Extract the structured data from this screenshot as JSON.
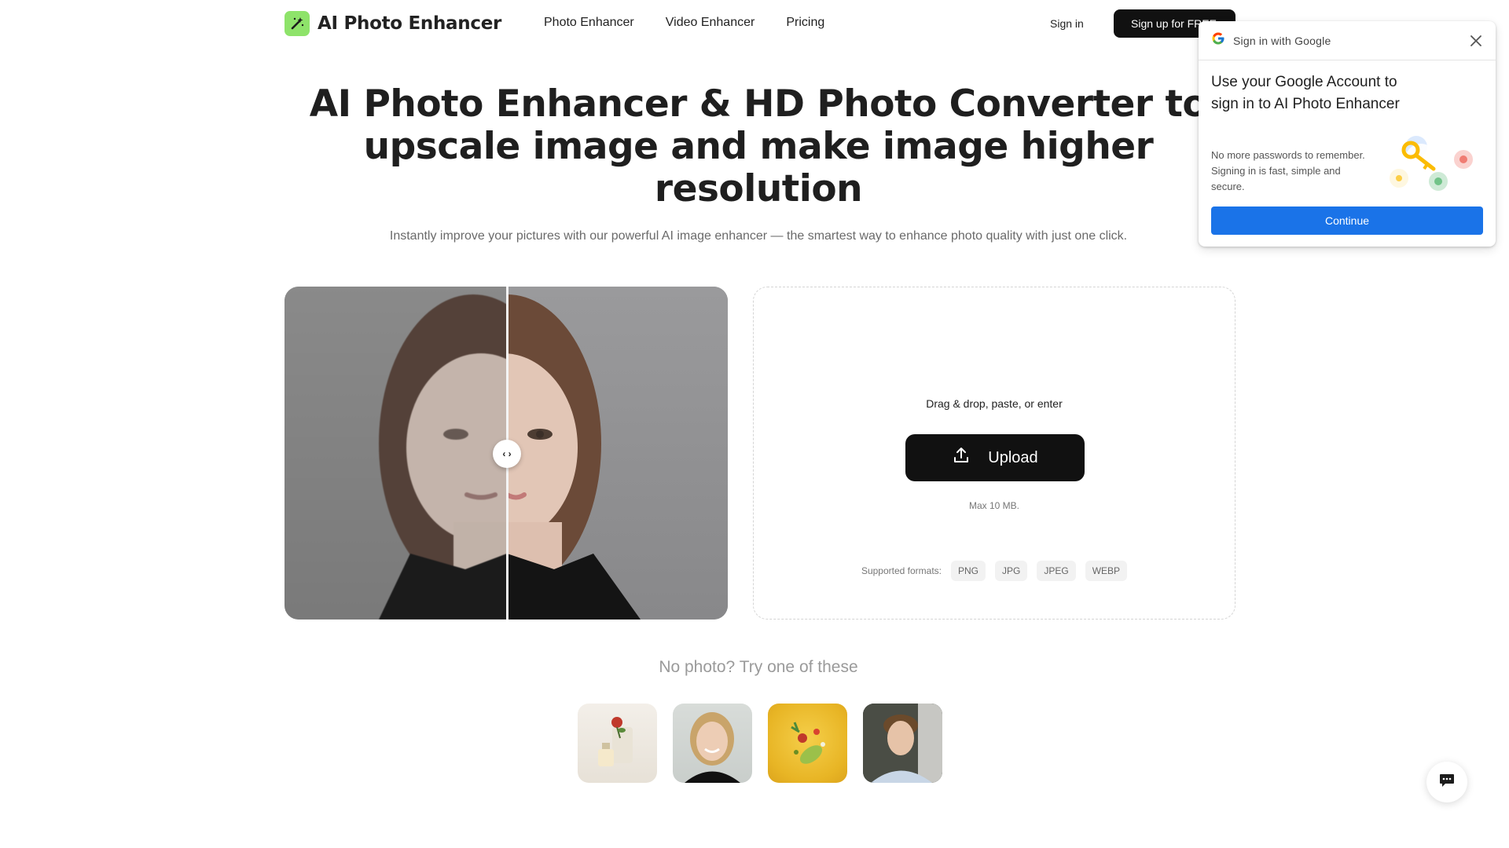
{
  "header": {
    "logo_text": "AI Photo Enhancer",
    "nav": [
      "Photo Enhancer",
      "Video Enhancer",
      "Pricing"
    ],
    "signin_label": "Sign in",
    "signup_label": "Sign up for FREE"
  },
  "hero": {
    "title": "AI Photo Enhancer & HD Photo Converter to upscale image and make image higher resolution",
    "subtitle": "Instantly improve your pictures with our powerful AI image enhancer — the smartest way to enhance photo quality with just one click."
  },
  "compare": {
    "handle_label": "‹ ›"
  },
  "upload": {
    "drag_text": "Drag & drop, paste, or enter",
    "button_label": "Upload",
    "max_text": "Max 10 MB.",
    "formats_label": "Supported formats:",
    "formats": [
      "PNG",
      "JPG",
      "JPEG",
      "WEBP"
    ]
  },
  "samples": {
    "heading": "No photo? Try one of these"
  },
  "google_popup": {
    "header": "Sign in with Google",
    "title": "Use your Google Account to sign in to AI Photo Enhancer",
    "body": "No more passwords to remember. Signing in is fast, simple and secure.",
    "continue_label": "Continue"
  },
  "colors": {
    "brand_green": "#8ee36a",
    "google_blue": "#1a73e8",
    "dark_button": "#111111"
  }
}
